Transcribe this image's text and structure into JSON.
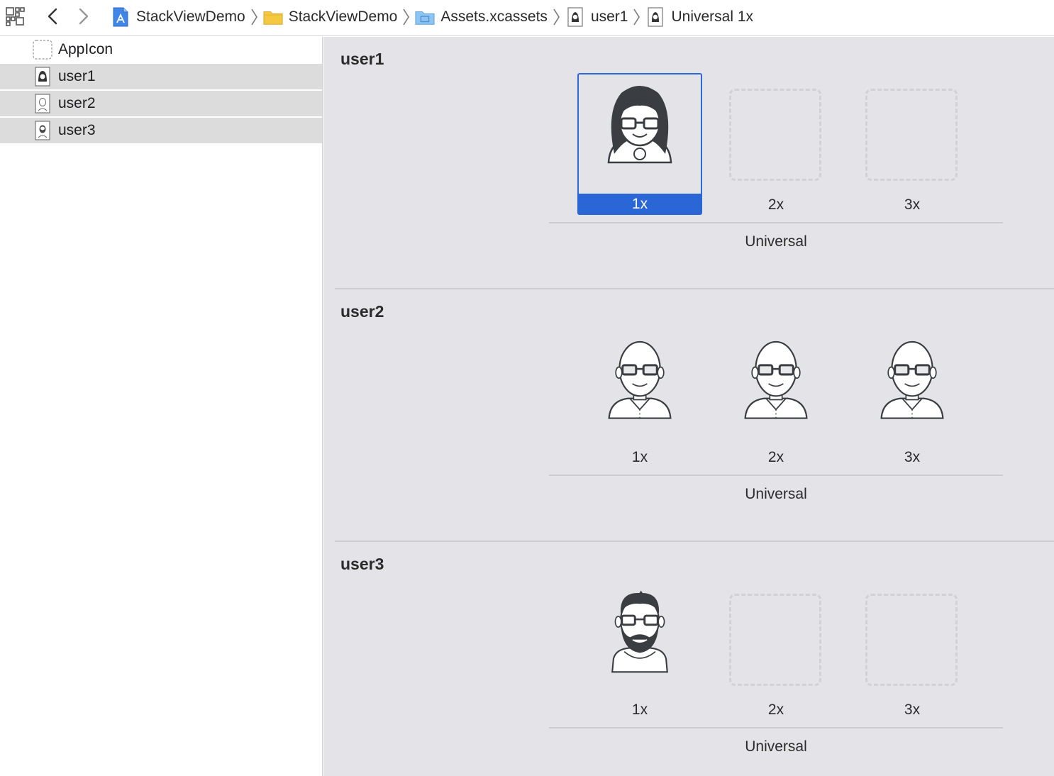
{
  "toolbar": {
    "grid_icon": "related-items-icon",
    "back_icon": "chevron-left-icon",
    "forward_icon": "chevron-right-icon",
    "breadcrumbs": [
      {
        "label": "StackViewDemo",
        "icon": "xcode-project-icon"
      },
      {
        "label": "StackViewDemo",
        "icon": "folder-icon"
      },
      {
        "label": "Assets.xcassets",
        "icon": "asset-catalog-icon"
      },
      {
        "label": "user1",
        "icon": "image-set-icon"
      },
      {
        "label": "Universal 1x",
        "icon": "image-set-icon"
      }
    ]
  },
  "sidebar": {
    "items": [
      {
        "label": "AppIcon",
        "icon": "app-icon-placeholder",
        "selected": false
      },
      {
        "label": "user1",
        "icon": "image-set-icon",
        "selected": true
      },
      {
        "label": "user2",
        "icon": "image-set-icon",
        "selected": true
      },
      {
        "label": "user3",
        "icon": "image-set-icon",
        "selected": true
      }
    ]
  },
  "sets": [
    {
      "name": "user1",
      "group": "Universal",
      "slots": [
        {
          "scale": "1x",
          "filled": true,
          "selected": true
        },
        {
          "scale": "2x",
          "filled": false
        },
        {
          "scale": "3x",
          "filled": false
        }
      ]
    },
    {
      "name": "user2",
      "group": "Universal",
      "slots": [
        {
          "scale": "1x",
          "filled": true
        },
        {
          "scale": "2x",
          "filled": true
        },
        {
          "scale": "3x",
          "filled": true
        }
      ]
    },
    {
      "name": "user3",
      "group": "Universal",
      "slots": [
        {
          "scale": "1x",
          "filled": true
        },
        {
          "scale": "2x",
          "filled": false
        },
        {
          "scale": "3x",
          "filled": false
        }
      ]
    }
  ],
  "colors": {
    "selection_blue": "#2a66d6",
    "canvas_bg": "#e4e4e8",
    "sidebar_selection": "#dcdcdc"
  }
}
